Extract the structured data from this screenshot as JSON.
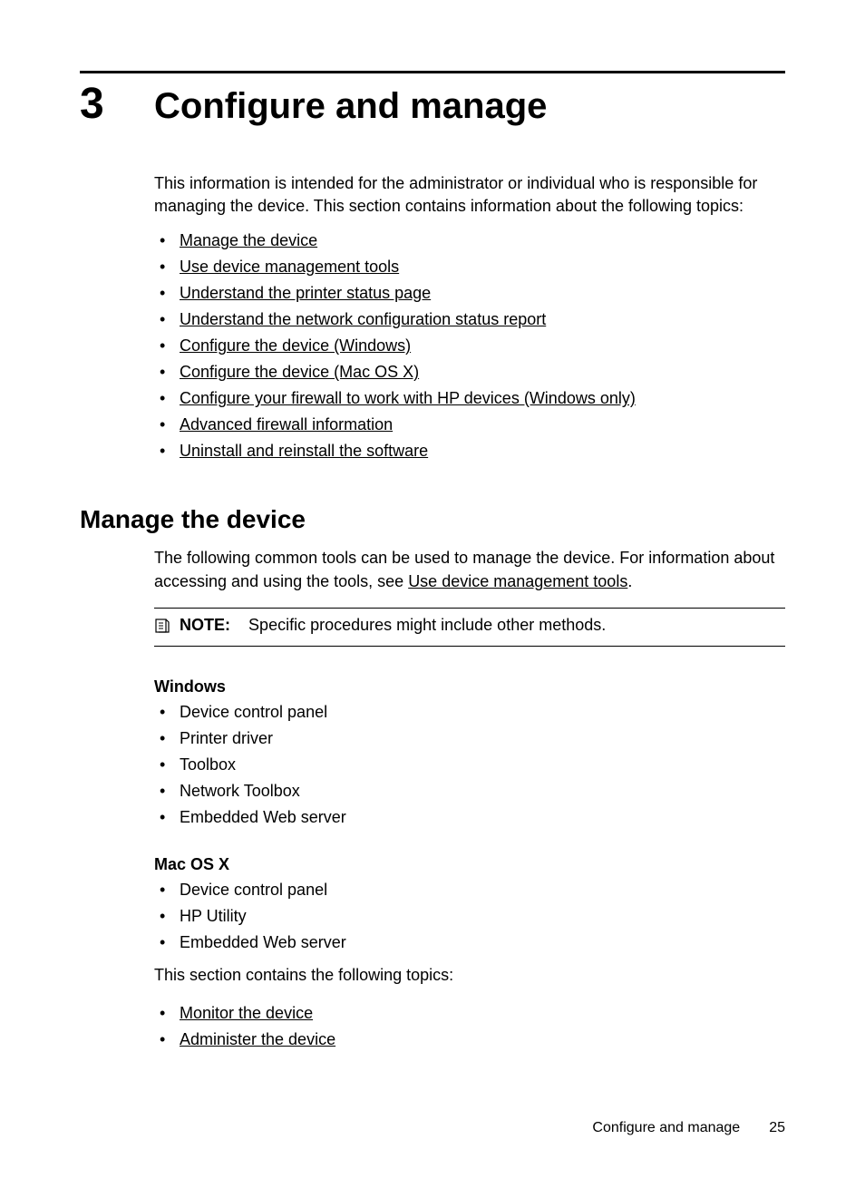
{
  "chapter": {
    "number": "3",
    "title": "Configure and manage",
    "intro": "This information is intended for the administrator or individual who is responsible for managing the device. This section contains information about the following topics:",
    "links": [
      "Manage the device",
      "Use device management tools",
      "Understand the printer status page",
      "Understand the network configuration status report",
      "Configure the device (Windows)",
      "Configure the device (Mac OS X)",
      "Configure your firewall to work with HP devices (Windows only)",
      "Advanced firewall information",
      "Uninstall and reinstall the software"
    ]
  },
  "section": {
    "heading": "Manage the device",
    "intro_pre": "The following common tools can be used to manage the device. For information about accessing and using the tools, see ",
    "intro_link": "Use device management tools",
    "intro_post": ".",
    "note_label": "NOTE:",
    "note_text": "Specific procedures might include other methods.",
    "windows_heading": "Windows",
    "windows_items": [
      "Device control panel",
      "Printer driver",
      "Toolbox",
      "Network Toolbox",
      "Embedded Web server"
    ],
    "mac_heading": "Mac OS X",
    "mac_items": [
      "Device control panel",
      "HP Utility",
      "Embedded Web server"
    ],
    "topics_intro": "This section contains the following topics:",
    "topics_links": [
      "Monitor the device",
      "Administer the device"
    ]
  },
  "footer": {
    "label": "Configure and manage",
    "page": "25"
  }
}
